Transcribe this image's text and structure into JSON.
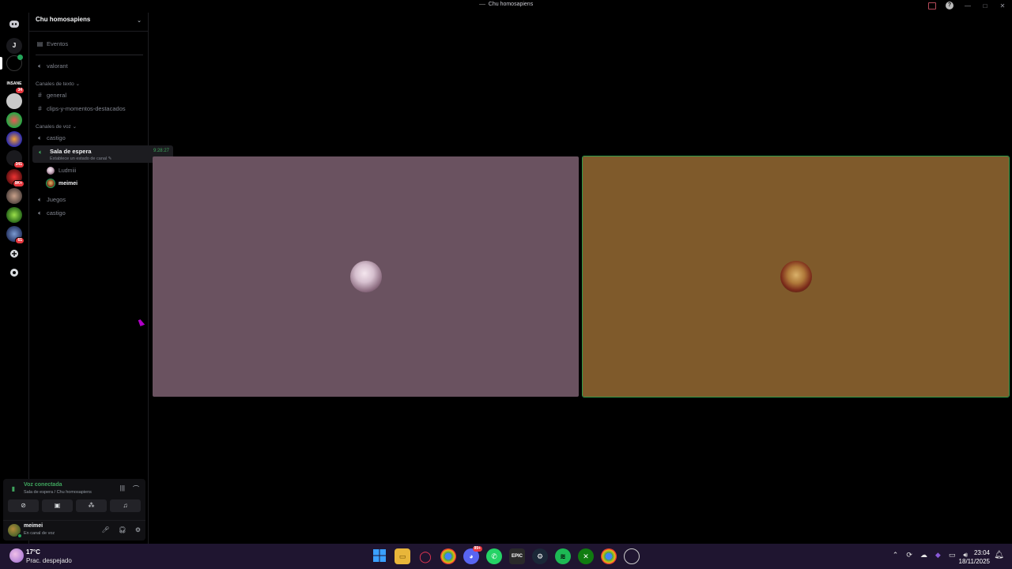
{
  "window": {
    "title": "Chu homosapiens"
  },
  "rail": {
    "user_initial": "J",
    "badges": [
      "34",
      "341",
      "9K+",
      "61"
    ]
  },
  "sidebar": {
    "server_name": "Chu homosapiens",
    "events_label": "Eventos",
    "top_voice_channel": "valorant",
    "text_category": "Canales de texto",
    "text_channels": [
      "general",
      "clips-y-momentos-destacados"
    ],
    "voice_category": "Canales de voz",
    "voice_channels_before": [
      "castigo"
    ],
    "active_channel": {
      "name": "Sala de espera",
      "time": "9:28:27",
      "status": "Establece un estado de canal"
    },
    "voice_users": [
      "Ludmiii",
      "meimei"
    ],
    "voice_channels_after": [
      "Juegos",
      "castigo"
    ]
  },
  "voice_panel": {
    "title": "Voz conectada",
    "subtitle": "Sala de espera / Chu homosapiens"
  },
  "user_panel": {
    "name": "meimei",
    "status": "En canal de voz"
  },
  "taskbar": {
    "temperature": "17°C",
    "weather": "Prac. despejado",
    "discord_badge": "99+",
    "time": "23:04",
    "date": "18/11/2025"
  },
  "colors": {
    "tile_left": "#6a5260",
    "tile_right": "#7f5a2b",
    "speaking_outline": "#2f9b4a",
    "voice_green": "#3fa45d"
  }
}
